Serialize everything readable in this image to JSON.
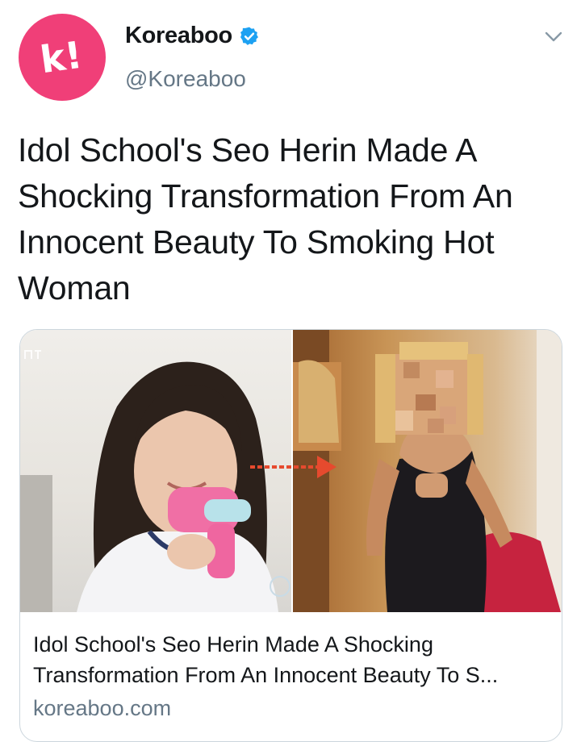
{
  "account": {
    "display_name": "Koreaboo",
    "handle": "@Koreaboo",
    "avatar_glyph": "k!",
    "brand_color": "#f03f78",
    "verified_color": "#1da1f2"
  },
  "tweet": {
    "lines": [
      "Idol School's Seo Herin Made A",
      "Shocking Transformation From An",
      "Innocent Beauty To Smoking Hot",
      "Woman"
    ]
  },
  "card": {
    "title_lines": [
      "Idol School's Seo Herin Made A Shocking",
      "Transformation From An Innocent Beauty To S..."
    ],
    "domain": "koreaboo.com"
  }
}
